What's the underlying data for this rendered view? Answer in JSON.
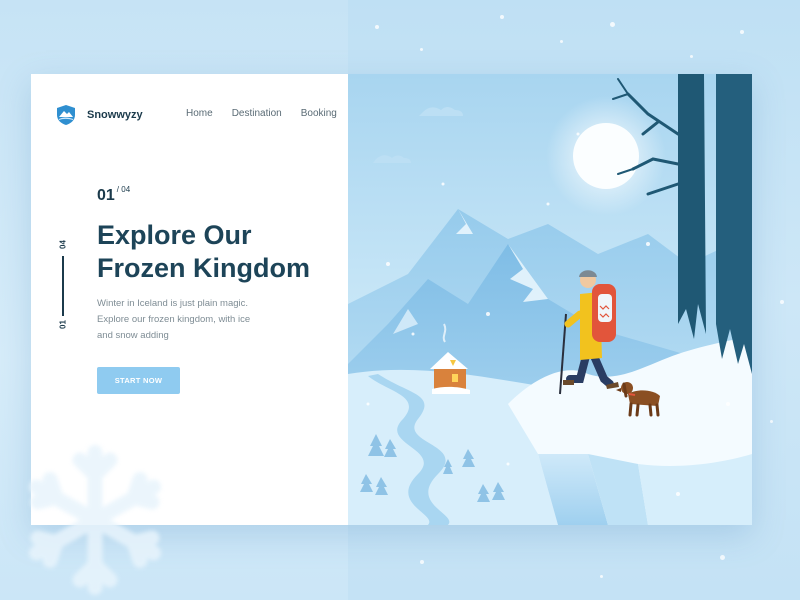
{
  "brand": {
    "name": "Snowwyzy",
    "logo": "mountain-shield-logo"
  },
  "nav": {
    "items": [
      "Home",
      "Destination",
      "Booking"
    ]
  },
  "slide": {
    "current": "01",
    "total": "/ 04",
    "indicator_top": "04",
    "indicator_bottom": "01"
  },
  "hero": {
    "title": "Explore Our Frozen Kingdom",
    "description": "Winter in Iceland is just plain magic. Explore our frozen kingdom, with ice and snow adding",
    "cta_label": "START NOW"
  },
  "colors": {
    "accent": "#8fcbf0",
    "heading": "#1d4458",
    "sky_top": "#a8d5f0",
    "snow": "#f4fbff",
    "hiker_jacket": "#f2c21e",
    "backpack": "#e2553b"
  }
}
